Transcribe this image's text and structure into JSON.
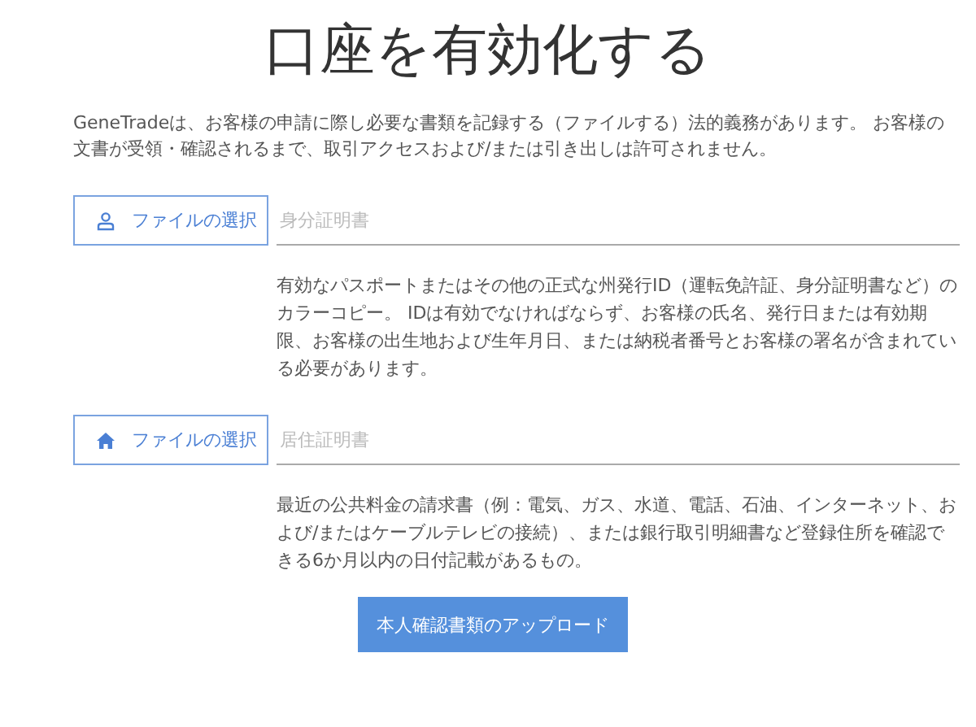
{
  "title": "口座を有効化する",
  "intro": "GeneTradeは、お客様の申請に際し必要な書類を記録する（ファイルする）法的義務があります。 お客様の文書が受領・確認されるまで、取引アクセスおよび/または引き出しは許可されません。",
  "documents": [
    {
      "kind": "person",
      "button": "ファイルの選択",
      "placeholder": "身分証明書",
      "description": "有効なパスポートまたはその他の正式な州発行ID（運転免許証、身分証明書など）のカラーコピー。 IDは有効でなければならず、お客様の氏名、発行日または有効期限、お客様の出生地および生年月日、または納税者番号とお客様の署名が含まれている必要があります。"
    },
    {
      "kind": "home",
      "button": "ファイルの選択",
      "placeholder": "居住証明書",
      "description": "最近の公共料金の請求書（例：電気、ガス、水道、電話、石油、インターネット、および/またはケーブルテレビの接続）、または銀行取引明細書など登録住所を確認できる6か月以内の日付記載があるもの。"
    }
  ],
  "upload_button": "本人確認書類のアップロード"
}
